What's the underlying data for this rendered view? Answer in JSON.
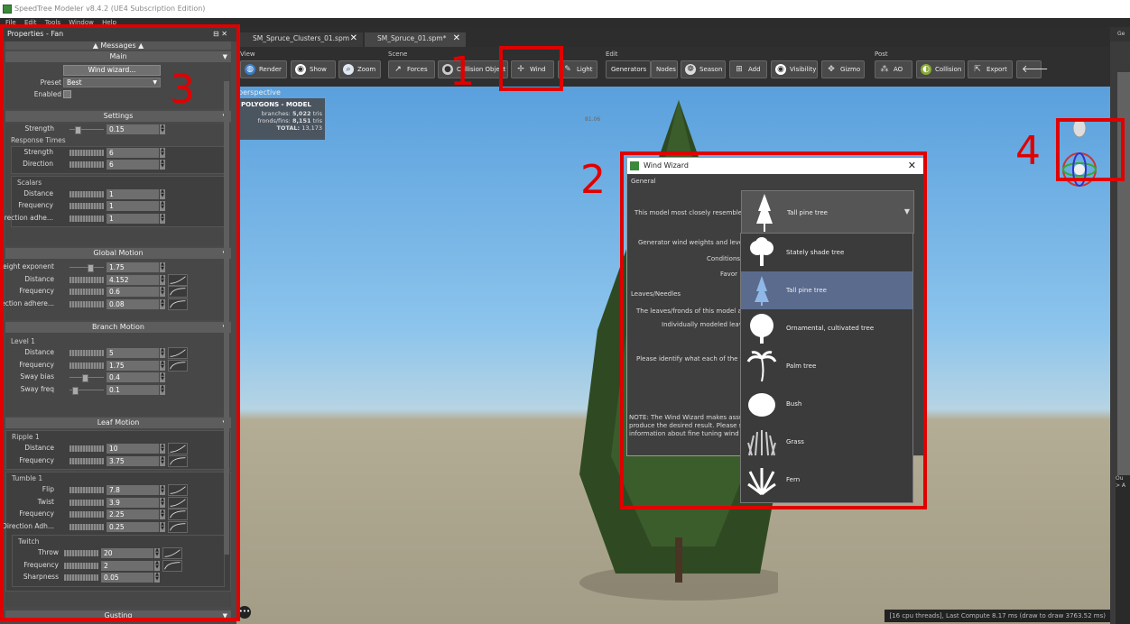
{
  "window": {
    "title": "SpeedTree Modeler v8.4.2 (UE4 Subscription Edition)"
  },
  "menu": {
    "items": [
      "File",
      "Edit",
      "Tools",
      "Window",
      "Help"
    ]
  },
  "properties": {
    "title": "Properties - Fan",
    "title_controls": "⊟ ✕",
    "messages_label": "▲ Messages ▲",
    "main": {
      "header": "Main",
      "wizard_button": "Wind wizard...",
      "preset_label": "Preset",
      "preset_value": "Best",
      "enabled_label": "Enabled"
    },
    "settings": {
      "header": "Settings",
      "strength_label": "Strength",
      "strength_value": "0.15",
      "response_times": "Response Times",
      "rt_strength_label": "Strength",
      "rt_strength_value": "6",
      "rt_direction_label": "Direction",
      "rt_direction_value": "6",
      "scalars": "Scalars",
      "distance_label": "Distance",
      "distance_value": "1",
      "frequency_label": "Frequency",
      "frequency_value": "1",
      "dir_adh_label": "Direction adhe...",
      "dir_adh_value": "1"
    },
    "global_motion": {
      "header": "Global Motion",
      "height_label": "Height exponent",
      "height_value": "1.75",
      "distance_label": "Distance",
      "distance_value": "4.152",
      "frequency_label": "Frequency",
      "frequency_value": "0.6",
      "dir_adh_label": "Direction adhere...",
      "dir_adh_value": "0.08"
    },
    "branch_motion": {
      "header": "Branch Motion",
      "level": "Level 1",
      "distance_label": "Distance",
      "distance_value": "5",
      "frequency_label": "Frequency",
      "frequency_value": "1.75",
      "sway_bias_label": "Sway bias",
      "sway_bias_value": "0.4",
      "sway_freq_label": "Sway freq",
      "sway_freq_value": "0.1"
    },
    "leaf_motion": {
      "header": "Leaf Motion",
      "ripple": "Ripple 1",
      "r_distance_label": "Distance",
      "r_distance_value": "10",
      "r_frequency_label": "Frequency",
      "r_frequency_value": "3.75",
      "tumble": "Tumble 1",
      "flip_label": "Flip",
      "flip_value": "7.8",
      "twist_label": "Twist",
      "twist_value": "3.9",
      "t_frequency_label": "Frequency",
      "t_frequency_value": "2.25",
      "t_dir_label": "Direction Adh...",
      "t_dir_value": "0.25",
      "twitch": "Twitch",
      "throw_label": "Throw",
      "throw_value": "20",
      "w_frequency_label": "Frequency",
      "w_frequency_value": "2",
      "sharpness_label": "Sharpness",
      "sharpness_value": "0.05"
    },
    "gusting": {
      "header": "Gusting"
    }
  },
  "tabs": [
    {
      "label": "SM_Spruce_Clusters_01.spm"
    },
    {
      "label": "SM_Spruce_01.spm*"
    }
  ],
  "toolbar": {
    "view": {
      "label": "View",
      "render": "Render",
      "show": "Show",
      "zoom": "Zoom"
    },
    "scene": {
      "label": "Scene",
      "forces": "Forces",
      "collision": "Collision Object",
      "wind": "Wind",
      "light": "Light"
    },
    "edit": {
      "label": "Edit",
      "generators": "Generators",
      "nodes": "Nodes",
      "season": "Season",
      "add": "Add",
      "visibility": "Visibility",
      "gizmo": "Gizmo"
    },
    "post": {
      "label": "Post",
      "ao": "AO",
      "collision": "Collision",
      "export": "Export"
    }
  },
  "viewport": {
    "mode": "perspective",
    "stats": {
      "header": "POLYGONS - MODEL",
      "branches_label": "branches:",
      "branches_value": "5,022",
      "branches_unit": "tris",
      "fronds_label": "fronds/fins:",
      "fronds_value": "8,151",
      "fronds_unit": "tris",
      "total_label": "TOTAL:",
      "total_value": "13,173"
    },
    "ruler_value": "81.06",
    "status": "[16 cpu threads], Last Compute 8.17 ms (draw to draw 3763.52 ms)"
  },
  "wizard": {
    "title": "Wind Wizard",
    "general": "General",
    "resembles": "This model most closely resembles a",
    "combo_value": "Tall pine tree",
    "gen_weights": "Generator wind weights and levels",
    "conditions": "Conditions",
    "favor": "Favor",
    "leaves_section": "Leaves/Needles",
    "leaves_text": "The leaves/fronds of this model are",
    "individual": "Individually modeled leaves",
    "identify": "Please identify what each of the fol",
    "note1": "NOTE:  The Wind Wizard makes assump",
    "note2": "produce the desired result.  Please see",
    "note3": "information about fine tuning wind beha",
    "options": [
      {
        "label": "Stately shade tree"
      },
      {
        "label": "Tall pine tree"
      },
      {
        "label": "Ornamental, cultivated tree"
      },
      {
        "label": "Palm tree"
      },
      {
        "label": "Bush"
      },
      {
        "label": "Grass"
      },
      {
        "label": "Fern"
      }
    ]
  },
  "annotations": {
    "n1": "1",
    "n2": "2",
    "n3": "3",
    "n4": "4"
  },
  "right_panel": {
    "title": "Ge",
    "log_title": "Ou",
    "log_line": "> A"
  },
  "colors": {
    "annotation": "#e00000",
    "selected_option": "#5a6b8e",
    "sky": "#8cc4ec"
  }
}
